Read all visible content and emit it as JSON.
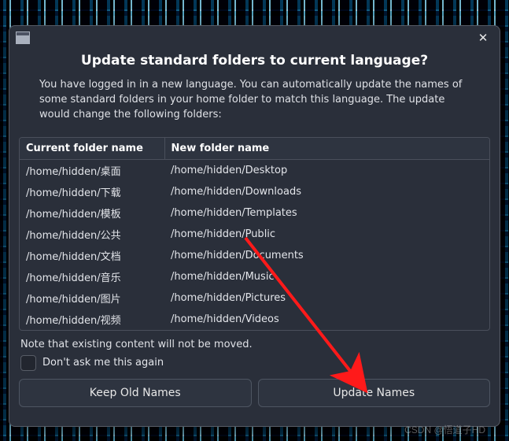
{
  "dialog": {
    "title": "Update standard folders to current language?",
    "description": "You have logged in in a new language. You can automatically update the names of some standard folders in your home folder to match this language. The update would change the following folders:",
    "note": "Note that existing content will not be moved.",
    "dont_ask_label": "Don't ask me this again",
    "keep_button": "Keep Old Names",
    "update_button": "Update Names"
  },
  "table": {
    "headers": {
      "current": "Current folder name",
      "new": "New folder name"
    },
    "rows": [
      {
        "current": "/home/hidden/桌面",
        "new": "/home/hidden/Desktop"
      },
      {
        "current": "/home/hidden/下载",
        "new": "/home/hidden/Downloads"
      },
      {
        "current": "/home/hidden/模板",
        "new": "/home/hidden/Templates"
      },
      {
        "current": "/home/hidden/公共",
        "new": "/home/hidden/Public"
      },
      {
        "current": "/home/hidden/文档",
        "new": "/home/hidden/Documents"
      },
      {
        "current": "/home/hidden/音乐",
        "new": "/home/hidden/Music"
      },
      {
        "current": "/home/hidden/图片",
        "new": "/home/hidden/Pictures"
      },
      {
        "current": "/home/hidden/视频",
        "new": "/home/hidden/Videos"
      }
    ]
  },
  "watermark": "CSDN @悟道子HD"
}
